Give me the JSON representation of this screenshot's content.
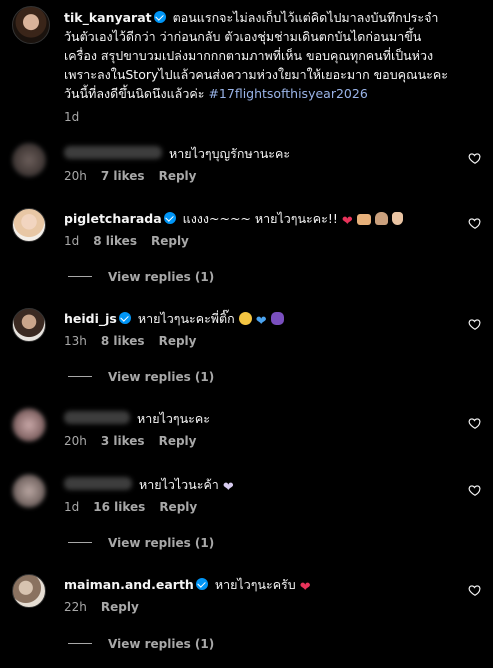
{
  "caption": {
    "username": "tik_kanyarat",
    "lines": [
      "ตอนแรกจะไม่ลงเก็บไว้แต่คิดไปมาลงบันทึกประจำ",
      "วันตัวเองไว้ดีกว่า ว่าก่อนกลับ ตัวเองชุ่มช่ามเดินตกบันไดก่อนมาขึ้น",
      "เครื่อง สรุปขาบวมเปล่งมากกกตามภาพที่เห็น ขอบคุณทุกคนที่เป็นห่วง",
      "เพราะลงในStoryไปแล้วคนส่งความห่วงใยมาให้เยอะมาก ขอบคุณนะคะ",
      "วันนี้ที่ลงดีขึ้นนิดนึงแล้วค่ะ"
    ],
    "hashtag": "#17flightsofthisyear2026",
    "time": "1d"
  },
  "comments": [
    {
      "username": "",
      "blurred": true,
      "text": "หายไวๆบุญรักษานะคะ",
      "time": "20h",
      "likes": "7 likes",
      "reply": "Reply",
      "view_replies": ""
    },
    {
      "username": "pigletcharada",
      "verified": true,
      "text": "แงงง~~~~ หายไวๆนะคะ!!",
      "emojis": [
        "heart",
        "hands",
        "pray",
        "victory"
      ],
      "time": "1d",
      "likes": "8 likes",
      "reply": "Reply",
      "view_replies": "View replies (1)"
    },
    {
      "username": "heidi_js",
      "verified": true,
      "text": "หายไวๆนะคะพี่ติ๊ก",
      "emojis": [
        "face",
        "blueheart",
        "grape"
      ],
      "time": "13h",
      "likes": "8 likes",
      "reply": "Reply",
      "view_replies": "View replies (1)"
    },
    {
      "username": "",
      "blurred": true,
      "text": "หายไวๆนะคะ",
      "time": "20h",
      "likes": "3 likes",
      "reply": "Reply",
      "view_replies": ""
    },
    {
      "username": "",
      "blurred": true,
      "text": "หายไวไวนะค้า",
      "emojis": [
        "whiteheart"
      ],
      "time": "1d",
      "likes": "16 likes",
      "reply": "Reply",
      "view_replies": "View replies (1)"
    },
    {
      "username": "maiman.and.earth",
      "verified": true,
      "text": "หายไวๆนะครับ",
      "emojis": [
        "heart"
      ],
      "time": "22h",
      "likes": "",
      "reply": "Reply",
      "view_replies": "View replies (1)"
    }
  ],
  "icons": {
    "like": "heart-outline-icon",
    "verified": "verified-badge-icon"
  },
  "colors": {
    "background": "#000000",
    "text": "#f5f5f5",
    "muted": "#a8a8a8",
    "hashtag": "#9ab4e8",
    "verified": "#0095f6",
    "heart": "#e8335a"
  }
}
